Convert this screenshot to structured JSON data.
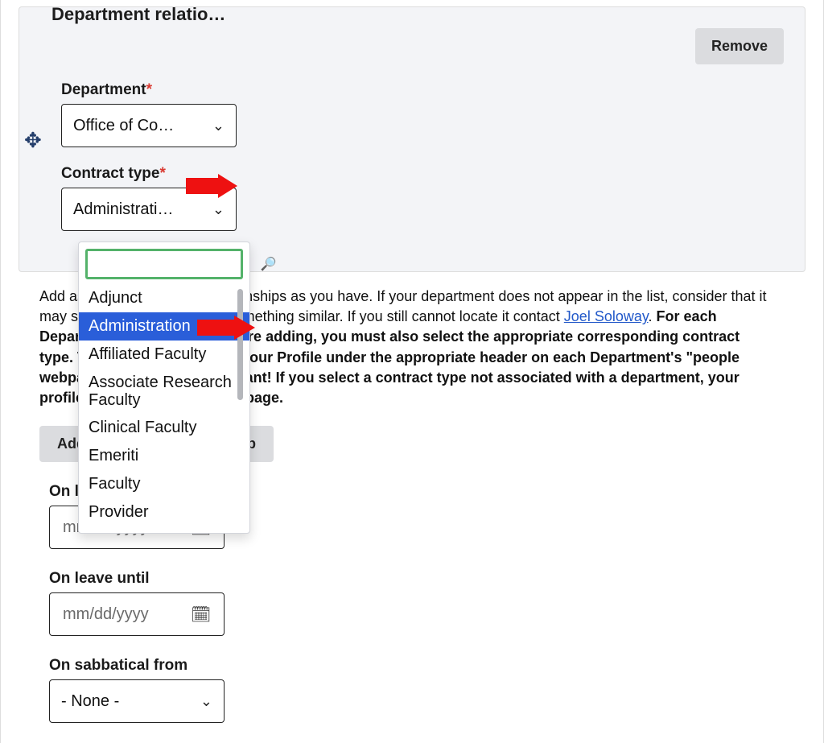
{
  "entry_title": "Department relatio…",
  "remove_label": "Remove",
  "department": {
    "label": "Department",
    "value": "Office of Co…"
  },
  "contract": {
    "label": "Contract type",
    "value": "Administrati…",
    "search_placeholder": "",
    "options": [
      "Adjunct",
      "Administration",
      "Affiliated Faculty",
      "Associate Research Faculty",
      "Clinical Faculty",
      "Emeriti",
      "Faculty",
      "Provider"
    ],
    "selected_index": 1
  },
  "help": {
    "t1": "Add as many department relationships as you have. If your department does not appear in the list, consider that it may start with 'Office of…' or something similar. If you still cannot locate it contact ",
    "link": "Joel Soloway",
    "t2": ". ",
    "b1": "For each Department relationship you are adding, you must also select the appropriate corresponding contract type. This will properly place your Profile under the appropriate header on each Department's \"people webpage.\" This field is important! If you select a contract type not associated with a department, your profile will not appear on that page."
  },
  "add_label": "Add Department relationship",
  "on_leave_from": {
    "label": "On leave from",
    "placeholder": "mm/dd/yyyy"
  },
  "on_leave_until": {
    "label": "On leave until",
    "placeholder": "mm/dd/yyyy"
  },
  "on_sabbatical_from": {
    "label": "On sabbatical from",
    "value": "- None -"
  }
}
